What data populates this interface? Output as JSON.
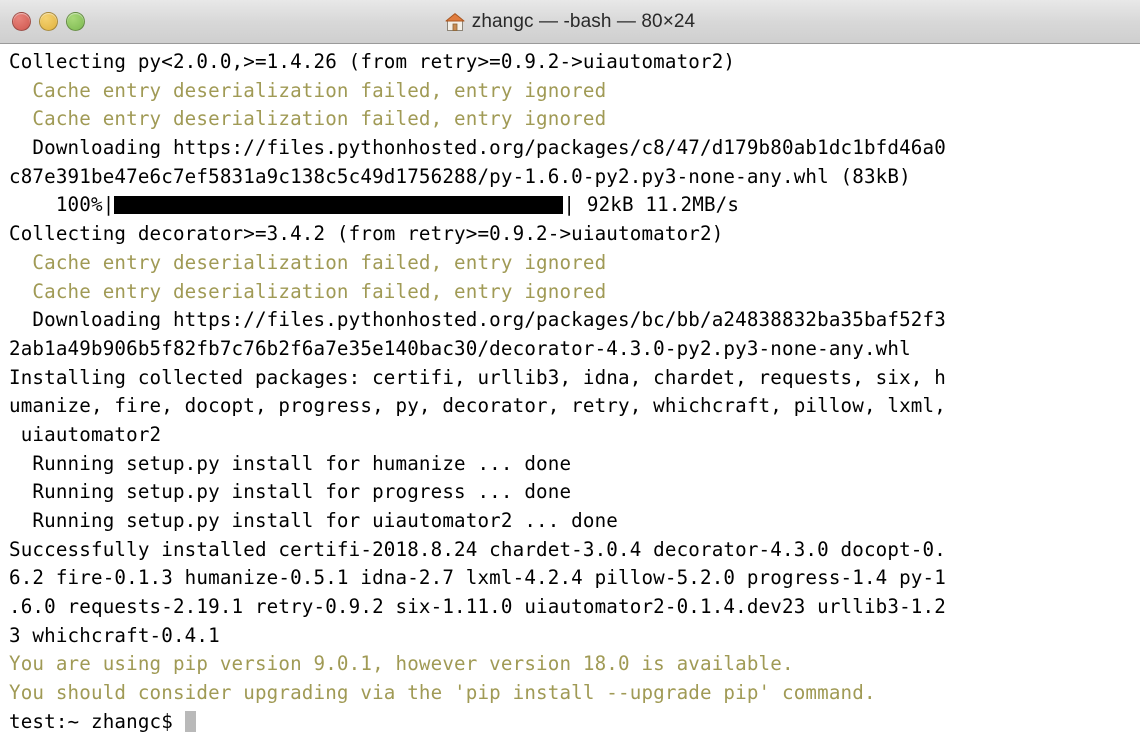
{
  "window": {
    "title": "zhangc — -bash — 80×24",
    "icon": "home-icon",
    "controls": {
      "close_label": "close",
      "minimize_label": "minimize",
      "zoom_label": "zoom"
    }
  },
  "terminal": {
    "columns": 80,
    "rows": 24,
    "background_color": "#ffffff",
    "foreground_color": "#000000",
    "dim_color": "#a09a55",
    "cursor_color": "#b9b9b9",
    "lines": [
      {
        "text": "Collecting py<2.0.0,>=1.4.26 (from retry>=0.9.2->uiautomator2)",
        "style": "normal"
      },
      {
        "text": "  Cache entry deserialization failed, entry ignored",
        "style": "dim"
      },
      {
        "text": "  Cache entry deserialization failed, entry ignored",
        "style": "dim"
      },
      {
        "text": "  Downloading https://files.pythonhosted.org/packages/c8/47/d179b80ab1dc1bfd46a0",
        "style": "normal"
      },
      {
        "text": "c87e391be47e6c7ef5831a9c138c5c49d1756288/py-1.6.0-py2.py3-none-any.whl (83kB)",
        "style": "normal"
      },
      {
        "text": "PROGRESS",
        "style": "progress"
      },
      {
        "text": "Collecting decorator>=3.4.2 (from retry>=0.9.2->uiautomator2)",
        "style": "normal"
      },
      {
        "text": "  Cache entry deserialization failed, entry ignored",
        "style": "dim"
      },
      {
        "text": "  Cache entry deserialization failed, entry ignored",
        "style": "dim"
      },
      {
        "text": "  Downloading https://files.pythonhosted.org/packages/bc/bb/a24838832ba35baf52f3",
        "style": "normal"
      },
      {
        "text": "2ab1a49b906b5f82fb7c76b2f6a7e35e140bac30/decorator-4.3.0-py2.py3-none-any.whl",
        "style": "normal"
      },
      {
        "text": "Installing collected packages: certifi, urllib3, idna, chardet, requests, six, h",
        "style": "normal"
      },
      {
        "text": "umanize, fire, docopt, progress, py, decorator, retry, whichcraft, pillow, lxml,",
        "style": "normal"
      },
      {
        "text": " uiautomator2",
        "style": "normal"
      },
      {
        "text": "  Running setup.py install for humanize ... done",
        "style": "normal"
      },
      {
        "text": "  Running setup.py install for progress ... done",
        "style": "normal"
      },
      {
        "text": "  Running setup.py install for uiautomator2 ... done",
        "style": "normal"
      },
      {
        "text": "Successfully installed certifi-2018.8.24 chardet-3.0.4 decorator-4.3.0 docopt-0.",
        "style": "normal"
      },
      {
        "text": "6.2 fire-0.1.3 humanize-0.5.1 idna-2.7 lxml-4.2.4 pillow-5.2.0 progress-1.4 py-1",
        "style": "normal"
      },
      {
        "text": ".6.0 requests-2.19.1 retry-0.9.2 six-1.11.0 uiautomator2-0.1.4.dev23 urllib3-1.2",
        "style": "normal"
      },
      {
        "text": "3 whichcraft-0.4.1",
        "style": "normal"
      },
      {
        "text": "You are using pip version 9.0.1, however version 18.0 is available.",
        "style": "dim"
      },
      {
        "text": "You should consider upgrading via the 'pip install --upgrade pip' command.",
        "style": "dim"
      },
      {
        "text": "PROMPT",
        "style": "prompt"
      }
    ],
    "progress_line": {
      "percent_label": "    100%",
      "bar_open": "|",
      "bar_fill_char": "█",
      "bar_close": "|",
      "trailing_text": " 92kB 11.2MB/s",
      "percent_value": 100,
      "downloaded": "92kB",
      "rate": "11.2MB/s"
    },
    "prompt_line": {
      "prompt": "test:~ zhangc$ ",
      "input": "",
      "cursor": "block"
    }
  }
}
